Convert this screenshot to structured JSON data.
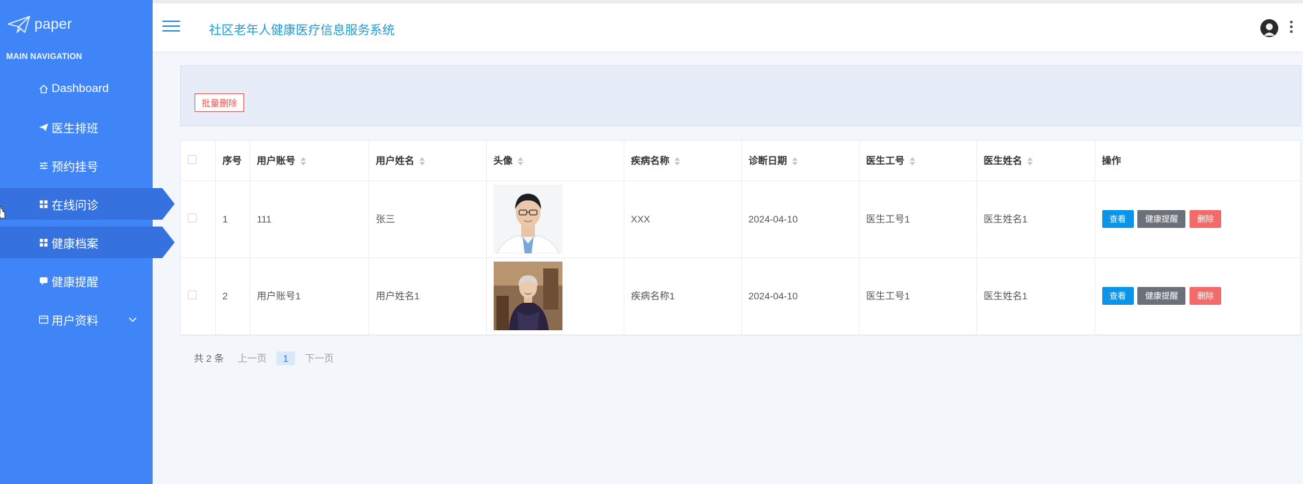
{
  "sidebar": {
    "brand": "paper",
    "nav_title": "MAIN NAVIGATION",
    "items": [
      {
        "label": "Dashboard",
        "icon": "home-icon"
      },
      {
        "label": "医生排班",
        "icon": "paper-plane-icon"
      },
      {
        "label": "预约挂号",
        "icon": "sliders-icon"
      },
      {
        "label": "在线问诊",
        "icon": "grid-icon"
      },
      {
        "label": "健康档案",
        "icon": "grid-icon"
      },
      {
        "label": "健康提醒",
        "icon": "chat-bubble-icon"
      },
      {
        "label": "用户资料",
        "icon": "id-card-icon"
      }
    ]
  },
  "header": {
    "title": "社区老年人健康医疗信息服务系统"
  },
  "toolbar": {
    "batch_delete": "批量删除"
  },
  "table": {
    "columns": [
      "序号",
      "用户账号",
      "用户姓名",
      "头像",
      "疾病名称",
      "诊断日期",
      "医生工号",
      "医生姓名",
      "操作"
    ],
    "rows": [
      {
        "index": "1",
        "account": "111",
        "name": "张三",
        "disease": "XXX",
        "date": "2024-04-10",
        "doctor_id": "医生工号1",
        "doctor_name": "医生姓名1"
      },
      {
        "index": "2",
        "account": "用户账号1",
        "name": "用户姓名1",
        "disease": "疾病名称1",
        "date": "2024-04-10",
        "doctor_id": "医生工号1",
        "doctor_name": "医生姓名1"
      }
    ],
    "actions": {
      "view": "查看",
      "remind": "健康提醒",
      "delete": "删除"
    }
  },
  "pagination": {
    "total": "共 2 条",
    "prev": "上一页",
    "current": "1",
    "next": "下一页"
  },
  "colors": {
    "sidebar": "#3f85f8",
    "sidebar_active": "#3572e0",
    "title": "#1e9bd7",
    "view": "#0d94e8",
    "remind": "#6b7079",
    "delete": "#f36a6a"
  }
}
